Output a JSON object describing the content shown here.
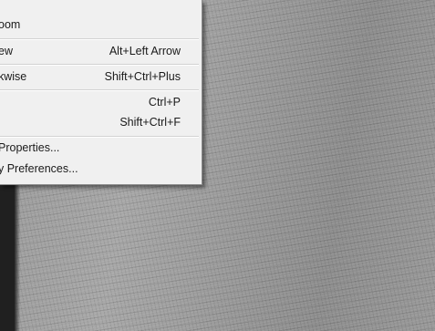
{
  "menu": {
    "items": [
      {
        "label": "oom",
        "shortcut": ""
      },
      {
        "label": "ew",
        "shortcut": "Alt+Left Arrow"
      },
      {
        "label": "kwise",
        "shortcut": "Shift+Ctrl+Plus"
      },
      {
        "label": "",
        "shortcut": "Ctrl+P"
      },
      {
        "label": "",
        "shortcut": "Shift+Ctrl+F"
      },
      {
        "label": "Properties...",
        "shortcut": ""
      },
      {
        "label": "y Preferences...",
        "shortcut": ""
      }
    ]
  }
}
